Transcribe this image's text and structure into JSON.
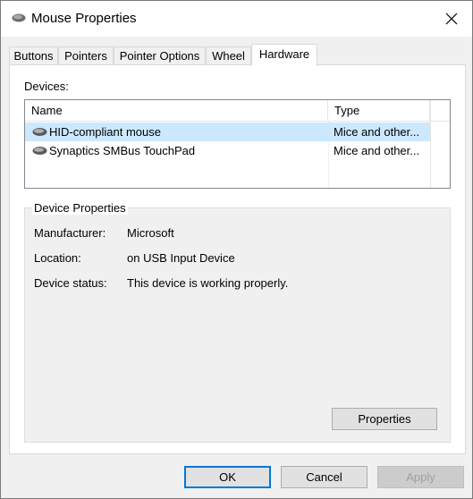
{
  "window": {
    "title": "Mouse Properties"
  },
  "tabs": [
    {
      "label": "Buttons"
    },
    {
      "label": "Pointers"
    },
    {
      "label": "Pointer Options"
    },
    {
      "label": "Wheel"
    },
    {
      "label": "Hardware",
      "active": true
    }
  ],
  "devices": {
    "label": "Devices:",
    "columns": {
      "name": "Name",
      "type": "Type"
    },
    "rows": [
      {
        "name": "HID-compliant mouse",
        "type": "Mice and other...",
        "selected": true
      },
      {
        "name": "Synaptics SMBus TouchPad",
        "type": "Mice and other...",
        "selected": false
      }
    ]
  },
  "device_properties": {
    "title": "Device Properties",
    "manufacturer_label": "Manufacturer:",
    "manufacturer_value": "Microsoft",
    "location_label": "Location:",
    "location_value": "on USB Input Device",
    "status_label": "Device status:",
    "status_value": "This device is working properly.",
    "properties_button": "Properties"
  },
  "footer": {
    "ok": "OK",
    "cancel": "Cancel",
    "apply": "Apply"
  },
  "colors": {
    "selection": "#cce8ff",
    "accent": "#0078d7",
    "panel": "#f0f0f0"
  },
  "icons": {
    "title": "mouse-icon",
    "close": "close-icon",
    "device": "mouse-device-icon"
  }
}
